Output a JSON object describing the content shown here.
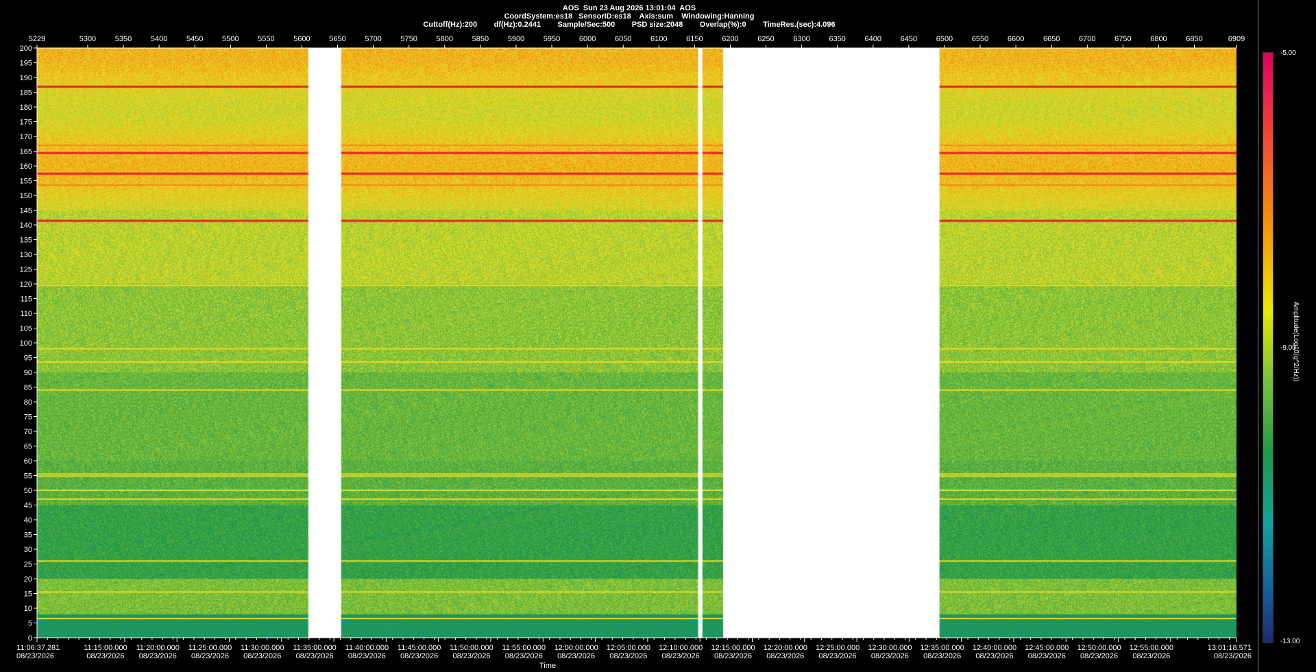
{
  "header": {
    "line1": "AOS  Sun 23 Aug 2026 13:01:04  AOS",
    "line2": "CoordSystem:es18   SensorID:es18    Axis:sum    Windowing:Hanning",
    "line3": "Cuttoff(Hz):200        df(Hz):0.2441        Sample/Sec:500        PSD size:2048        Overlap(%):0        TimeRes.(sec):4.096"
  },
  "chart_data": {
    "type": "heatmap",
    "title": "",
    "xlabel": "Time",
    "ylabel": "",
    "ylim": [
      0,
      200
    ],
    "y_ticks": [
      "0",
      "5",
      "10",
      "15",
      "20",
      "25",
      "30",
      "35",
      "40",
      "45",
      "50",
      "55",
      "60",
      "65",
      "70",
      "75",
      "80",
      "85",
      "90",
      "95",
      "100",
      "105",
      "110",
      "115",
      "120",
      "125",
      "130",
      "135",
      "140",
      "145",
      "150",
      "155",
      "160",
      "165",
      "170",
      "175",
      "180",
      "185",
      "190",
      "195",
      "200"
    ],
    "top_axis_range": [
      5229,
      6909
    ],
    "top_ticks": [
      "5229",
      "5300",
      "5350",
      "5400",
      "5450",
      "5500",
      "5550",
      "5600",
      "5650",
      "5700",
      "5750",
      "5800",
      "5850",
      "5900",
      "5950",
      "6000",
      "6050",
      "6100",
      "6150",
      "6200",
      "6250",
      "6300",
      "6350",
      "6400",
      "6450",
      "6500",
      "6550",
      "6600",
      "6650",
      "6700",
      "6750",
      "6800",
      "6850",
      "6909"
    ],
    "top_tick_values": [
      5229,
      5300,
      5350,
      5400,
      5450,
      5500,
      5550,
      5600,
      5650,
      5700,
      5750,
      5800,
      5850,
      5900,
      5950,
      6000,
      6050,
      6100,
      6150,
      6200,
      6250,
      6300,
      6350,
      6400,
      6450,
      6500,
      6550,
      6600,
      6650,
      6700,
      6750,
      6800,
      6850,
      6909
    ],
    "time_ticks": [
      {
        "time": "11:06:37.281",
        "date": "08/23/2026",
        "t": 0
      },
      {
        "time": "11:15:00.000",
        "date": "08/23/2026",
        "t": 503
      },
      {
        "time": "11:20:00.000",
        "date": "08/23/2026",
        "t": 803
      },
      {
        "time": "11:25:00.000",
        "date": "08/23/2026",
        "t": 1103
      },
      {
        "time": "11:30:00.000",
        "date": "08/23/2026",
        "t": 1403
      },
      {
        "time": "11:35:00.000",
        "date": "08/23/2026",
        "t": 1703
      },
      {
        "time": "11:40:00.000",
        "date": "08/23/2026",
        "t": 2003
      },
      {
        "time": "11:45:00.000",
        "date": "08/23/2026",
        "t": 2303
      },
      {
        "time": "11:50:00.000",
        "date": "08/23/2026",
        "t": 2603
      },
      {
        "time": "11:55:00.000",
        "date": "08/23/2026",
        "t": 2903
      },
      {
        "time": "12:00:00.000",
        "date": "08/23/2026",
        "t": 3203
      },
      {
        "time": "12:05:00.000",
        "date": "08/23/2026",
        "t": 3503
      },
      {
        "time": "12:10:00.000",
        "date": "08/23/2026",
        "t": 3803
      },
      {
        "time": "12:15:00.000",
        "date": "08/23/2026",
        "t": 4103
      },
      {
        "time": "12:20:00.000",
        "date": "08/23/2026",
        "t": 4403
      },
      {
        "time": "12:25:00.000",
        "date": "08/23/2026",
        "t": 4703
      },
      {
        "time": "12:30:00.000",
        "date": "08/23/2026",
        "t": 5003
      },
      {
        "time": "12:35:00.000",
        "date": "08/23/2026",
        "t": 5303
      },
      {
        "time": "12:40:00.000",
        "date": "08/23/2026",
        "t": 5603
      },
      {
        "time": "12:45:00.000",
        "date": "08/23/2026",
        "t": 5903
      },
      {
        "time": "12:50:00.000",
        "date": "08/23/2026",
        "t": 6203
      },
      {
        "time": "12:55:00.000",
        "date": "08/23/2026",
        "t": 6503
      },
      {
        "time": "13:01:18.571",
        "date": "08/23/2026",
        "t": 6881
      }
    ],
    "gaps_top_units": [
      [
        5609,
        5655
      ],
      [
        6155,
        6161
      ],
      [
        6190,
        6493
      ]
    ],
    "lines_hz": [
      {
        "hz": 187,
        "level": "red"
      },
      {
        "hz": 164.5,
        "level": "red"
      },
      {
        "hz": 157.5,
        "level": "red"
      },
      {
        "hz": 141.5,
        "level": "red"
      },
      {
        "hz": 153.5,
        "level": "orange"
      },
      {
        "hz": 167,
        "level": "orange"
      },
      {
        "hz": 119.5,
        "level": "yellow"
      },
      {
        "hz": 98,
        "level": "yellow"
      },
      {
        "hz": 93.5,
        "level": "yellow"
      },
      {
        "hz": 84,
        "level": "yellow"
      },
      {
        "hz": 55.5,
        "level": "yellow"
      },
      {
        "hz": 54.8,
        "level": "yellow"
      },
      {
        "hz": 50,
        "level": "yellow"
      },
      {
        "hz": 47,
        "level": "yellow"
      },
      {
        "hz": 26,
        "level": "yellow"
      },
      {
        "hz": 15.5,
        "level": "yellow"
      },
      {
        "hz": 6.5,
        "level": "yellow"
      }
    ],
    "colorbar": {
      "max": "-5.00",
      "mid": "-9.00",
      "min": "-13.00",
      "label": "Amplitude(Log10(g^2/Hz))"
    }
  }
}
